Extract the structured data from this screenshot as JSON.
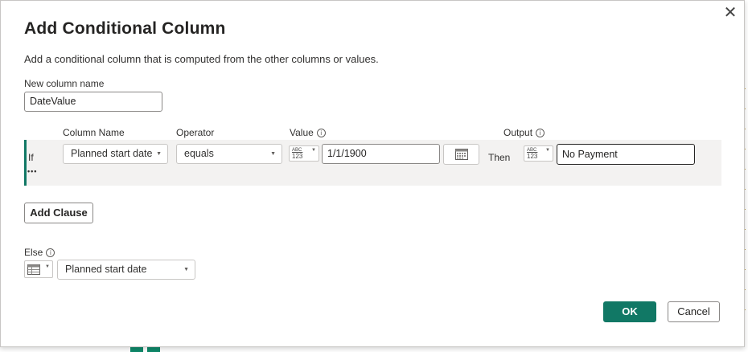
{
  "dialog": {
    "title": "Add Conditional Column",
    "description": "Add a conditional column that is computed from the other columns or values.",
    "close_symbol": "✕"
  },
  "new_column": {
    "label": "New column name",
    "value": "DateValue"
  },
  "clause_headers": {
    "column_name": "Column Name",
    "operator": "Operator",
    "value": "Value",
    "output": "Output"
  },
  "clause": {
    "if_label": "If",
    "more_symbol": "•••",
    "column_name": "Planned start date",
    "operator": "equals",
    "value_type": {
      "top": "ABC",
      "bottom": "123"
    },
    "value": "1/1/1900",
    "then_label": "Then",
    "output_type": {
      "top": "ABC",
      "bottom": "123"
    },
    "output": "No Payment"
  },
  "add_clause_label": "Add Clause",
  "else": {
    "label": "Else",
    "type_icon": "table-icon",
    "value": "Planned start date"
  },
  "footer": {
    "ok_label": "OK",
    "cancel_label": "Cancel"
  },
  "colors": {
    "primary": "#117865",
    "row_background": "#f3f2f1"
  },
  "icons": [
    "close-icon",
    "info-icon",
    "chevron-down-icon",
    "calendar-icon",
    "table-icon"
  ]
}
